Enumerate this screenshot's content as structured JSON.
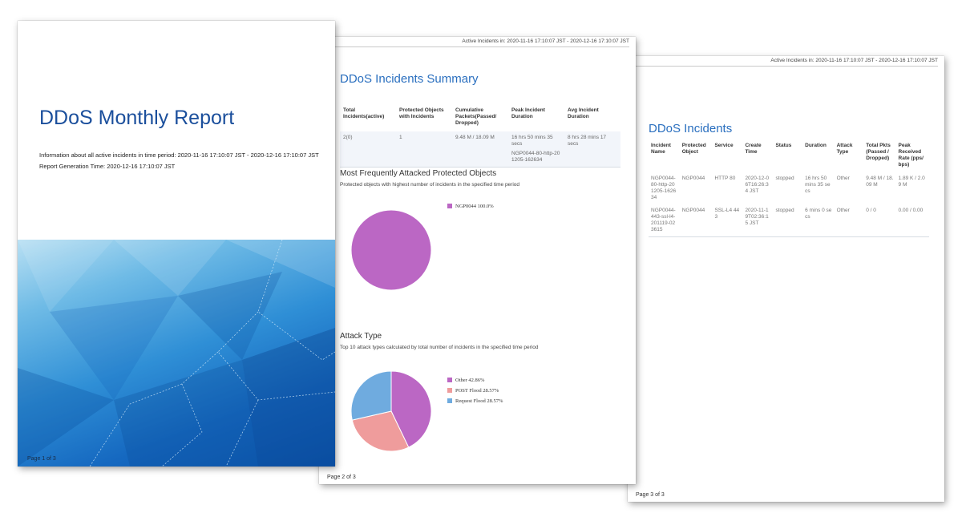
{
  "page1": {
    "title": "DDoS Monthly Report",
    "info_line": "Information about all active incidents in time period: 2020-11-16 17:10:07 JST - 2020-12-16 17:10:07 JST",
    "generation_line": "Report Generation Time: 2020-12-16 17:10:07 JST",
    "page_label": "Page 1 of 3"
  },
  "page2": {
    "header": "Active Incidents in: 2020-11-16 17:10:07 JST - 2020-12-16 17:10:07 JST",
    "title": "DDoS Incidents Summary",
    "summary_columns": [
      "Total Incidents(active)",
      "Protected Objects with Incidents",
      "Cumulative Packets(Passed/ Dropped)",
      "Peak Incident Duration",
      "Avg Incident Duration"
    ],
    "summary_row": {
      "total": "2(0)",
      "protected": "1",
      "packets": "9.48 M / 18.09 M",
      "peak_duration": "16 hrs 50 mins 35 secs",
      "peak_incident": "NGP0044-80-http-201205-162634",
      "avg_duration": "8 hrs 28 mins 17 secs"
    },
    "section1_title": "Most Frequently Attacked Protected Objects",
    "section1_desc": "Protected objects with highest number of incidents in the specified time period",
    "section2_title": "Attack Type",
    "section2_desc": "Top 10 attack types calculated by total number of incidents in the specified time period",
    "page_label": "Page 2 of 3"
  },
  "chart_data": [
    {
      "type": "pie",
      "labels": [
        "NGP0044"
      ],
      "values": [
        100.0
      ],
      "display": [
        "NGP0044   100.0%"
      ],
      "colors": [
        "#bb67c4"
      ],
      "legend_position": "right"
    },
    {
      "type": "pie",
      "labels": [
        "Other",
        "POST Flood",
        "Request Flood"
      ],
      "values": [
        42.86,
        28.57,
        28.57
      ],
      "display": [
        "Other  42.86%",
        "POST Flood  28.57%",
        "Request Flood  28.57%"
      ],
      "colors": [
        "#bb67c4",
        "#ef9c9c",
        "#6fabdf"
      ],
      "legend_position": "right"
    }
  ],
  "page3": {
    "header": "Active Incidents in: 2020-11-16 17:10:07 JST - 2020-12-16 17:10:07 JST",
    "title": "DDoS Incidents",
    "columns": [
      "Incident Name",
      "Protected Object",
      "Service",
      "Create Time",
      "Status",
      "Duration",
      "Attack Type",
      "Total Pkts (Passed / Dropped)",
      "Peak Received Rate (pps/ bps)"
    ],
    "rows": [
      [
        "NGP0044-80-http-201205-162634",
        "NGP0044",
        "HTTP 80",
        "2020-12-06T16:26:34 JST",
        "stopped",
        "16 hrs 50 mins 35 secs",
        "Other",
        "9.48 M / 18.09 M",
        "1.89 K / 2.09 M"
      ],
      [
        "NGP0044-443-ssl-l4-201119-023615",
        "NGP0044",
        "SSL-L4 443",
        "2020-11-19T02:36:15 JST",
        "stopped",
        "6 mins 0 secs",
        "Other",
        "0 / 0",
        "0.00 / 0.00"
      ]
    ],
    "page_label": "Page 3 of 3"
  }
}
